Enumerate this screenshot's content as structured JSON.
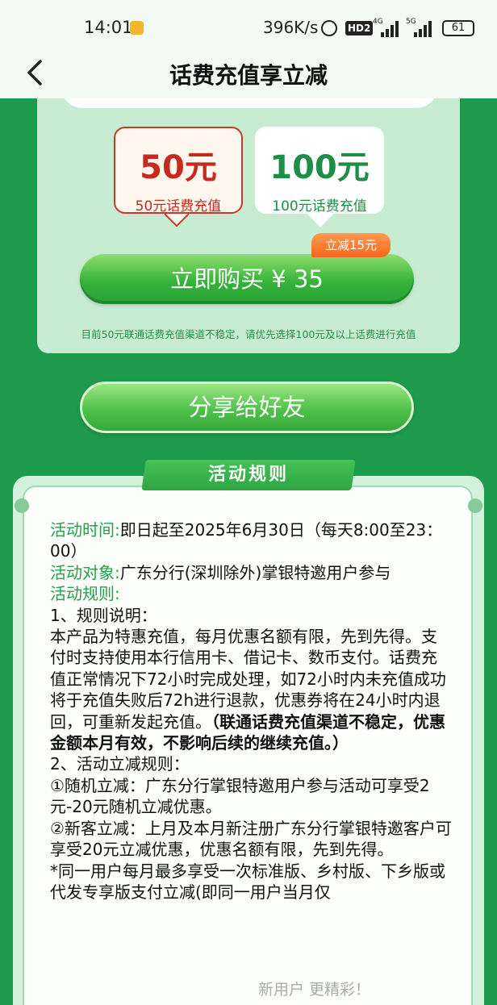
{
  "status": {
    "time": "14:01",
    "speed": "396K/s",
    "hd": "HD2",
    "net1": "4G",
    "net2": "5G",
    "battery": "61"
  },
  "nav": {
    "title": "话费充值享立减"
  },
  "amounts": [
    {
      "big": "50元",
      "small": "50元话费充值"
    },
    {
      "big": "100元",
      "small": "100元话费充值"
    }
  ],
  "badge": "立减15元",
  "buy_label": "立即购买 ¥ 35",
  "notice": "目前50元联通话费充值渠道不稳定，请优先选择100元及以上话费进行充值",
  "share_label": "分享给好友",
  "rules": {
    "header": "活动规则",
    "time_label": "活动时间:",
    "time_value": "即日起至2025年6月30日（每天8:00至23：00）",
    "target_label": "活动对象:",
    "target_value": "广东分行(深圳除外)掌银特邀用户参与",
    "rule_label": "活动规则:",
    "s1": "1、规则说明：",
    "p1": "本产品为特惠充值，每月优惠名额有限，先到先得。支付时支持使用本行信用卡、借记卡、数币支付。话费充值正常情况下72小时完成处理，如72小时内未充值成功将于充值失败后72h进行退款，优惠券将在24小时内退回，可重新发起充值。",
    "p1_bold": "（联通话费充值渠道不稳定，优惠金额本月有效，不影响后续的继续充值。）",
    "s2": "2、活动立减规则：",
    "r1": "①随机立减：广东分行掌银特邀用户参与活动可享受2元-20元随机立减优惠。",
    "r2": "②新客立减：上月及本月新注册广东分行掌银特邀客户可享受20元立减优惠，优惠名额有限，先到先得。",
    "r3": "*同一用户每月最多享受一次标准版、乡村版、下乡版或代发专享版支付立减(即同一用户当月仅"
  },
  "overlay": "新用户 更精彩！"
}
